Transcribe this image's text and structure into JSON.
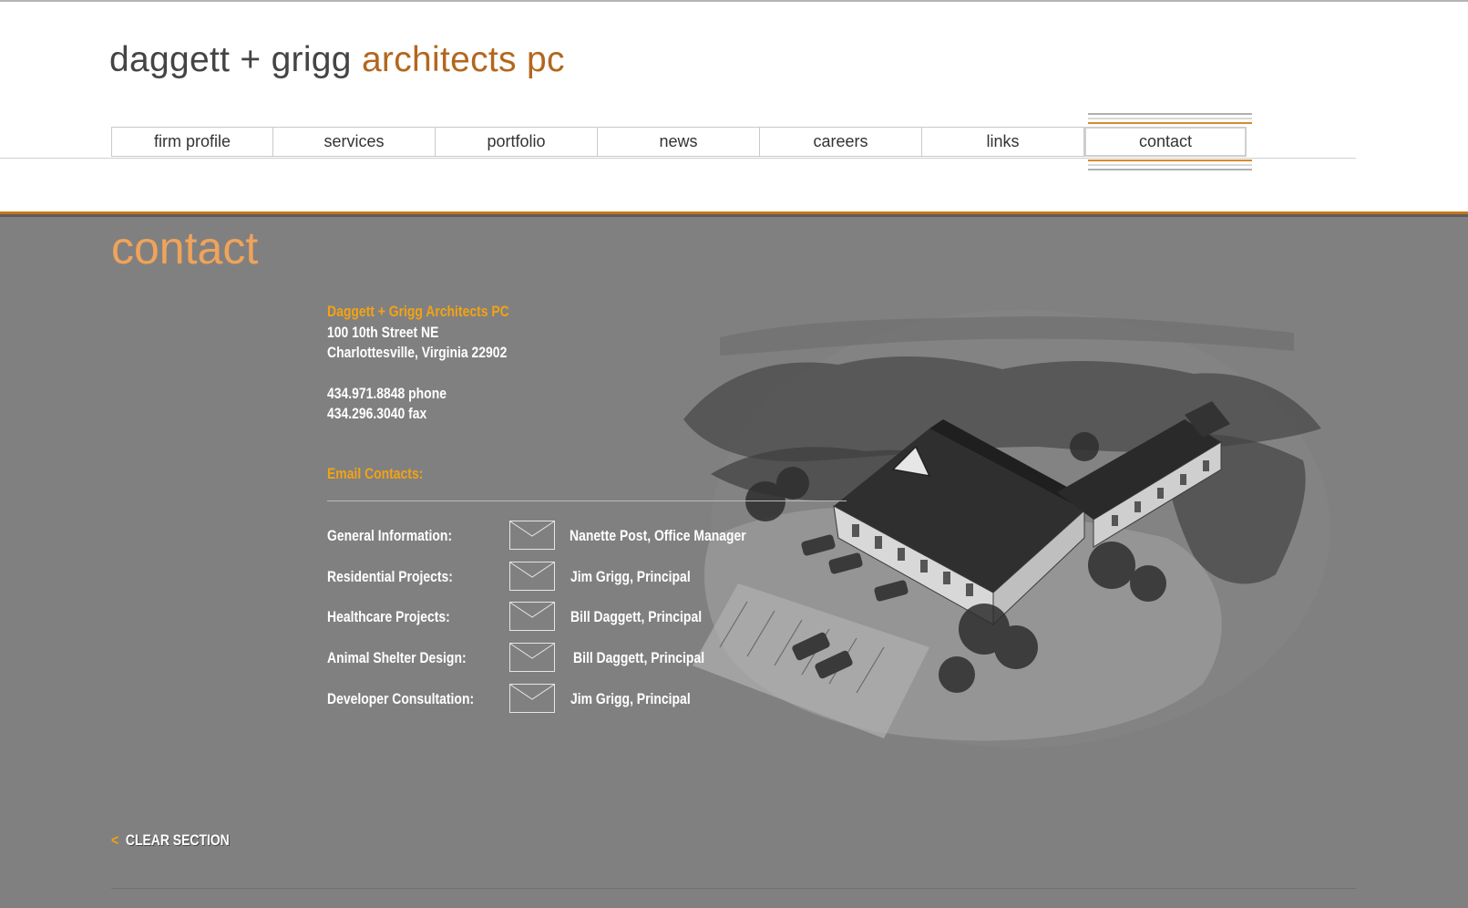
{
  "header": {
    "logo_main": "daggett + grigg ",
    "logo_accent": "architects pc"
  },
  "nav": {
    "items": [
      {
        "label": "firm profile"
      },
      {
        "label": "services"
      },
      {
        "label": "portfolio"
      },
      {
        "label": "news"
      },
      {
        "label": "careers"
      },
      {
        "label": "links"
      },
      {
        "label": "contact"
      }
    ],
    "active": "contact"
  },
  "page": {
    "heading": "contact"
  },
  "address": {
    "firm": "Daggett + Grigg Architects PC",
    "street": "100 10th Street NE",
    "city": "Charlottesville, Virginia 22902",
    "phone": "434.971.8848 phone",
    "fax": "434.296.3040 fax"
  },
  "email": {
    "heading": "Email Contacts:",
    "contacts": [
      {
        "label": "General Information:",
        "person": "Nanette Post, Office Manager"
      },
      {
        "label": "Residential Projects:",
        "person": "Jim Grigg, Principal"
      },
      {
        "label": "Healthcare Projects:",
        "person": "Bill Daggett, Principal"
      },
      {
        "label": "Animal Shelter Design:",
        "person": "Bill Daggett, Principal"
      },
      {
        "label": "Developer Consultation:",
        "person": "Jim Grigg, Principal"
      }
    ]
  },
  "footer": {
    "clear_arrow": "<",
    "clear_label": "CLEAR SECTION"
  },
  "colors": {
    "accent_orange": "#b3671d",
    "heading_orange": "#f0a35a",
    "gold": "#f2a313",
    "content_bg": "#808080"
  },
  "icons": {
    "envelope": "envelope-icon",
    "building_sketch": "building-sketch-illustration"
  }
}
